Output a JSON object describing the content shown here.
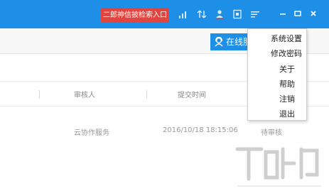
{
  "topbar": {
    "search_entry_label": "二郎神信披检索入口",
    "accent_color": "#1e8fe6",
    "icons": [
      "signal-icon",
      "transfer-icon",
      "user-upload-icon",
      "document-icon",
      "list-icon"
    ],
    "window_buttons": [
      "minimize-icon",
      "maximize-icon",
      "close-icon"
    ]
  },
  "toolbar": {
    "online_service_label": "在线服"
  },
  "table": {
    "headers": [
      "审核人",
      "提交时间"
    ],
    "rows": [
      {
        "reviewer": "云协作服务",
        "submit_time": "2016/10/18 18:15:06",
        "status": "待审核"
      }
    ]
  },
  "menu": {
    "items": [
      "系统设置",
      "修改密码",
      "关于",
      "帮助",
      "注销",
      "退出"
    ]
  }
}
